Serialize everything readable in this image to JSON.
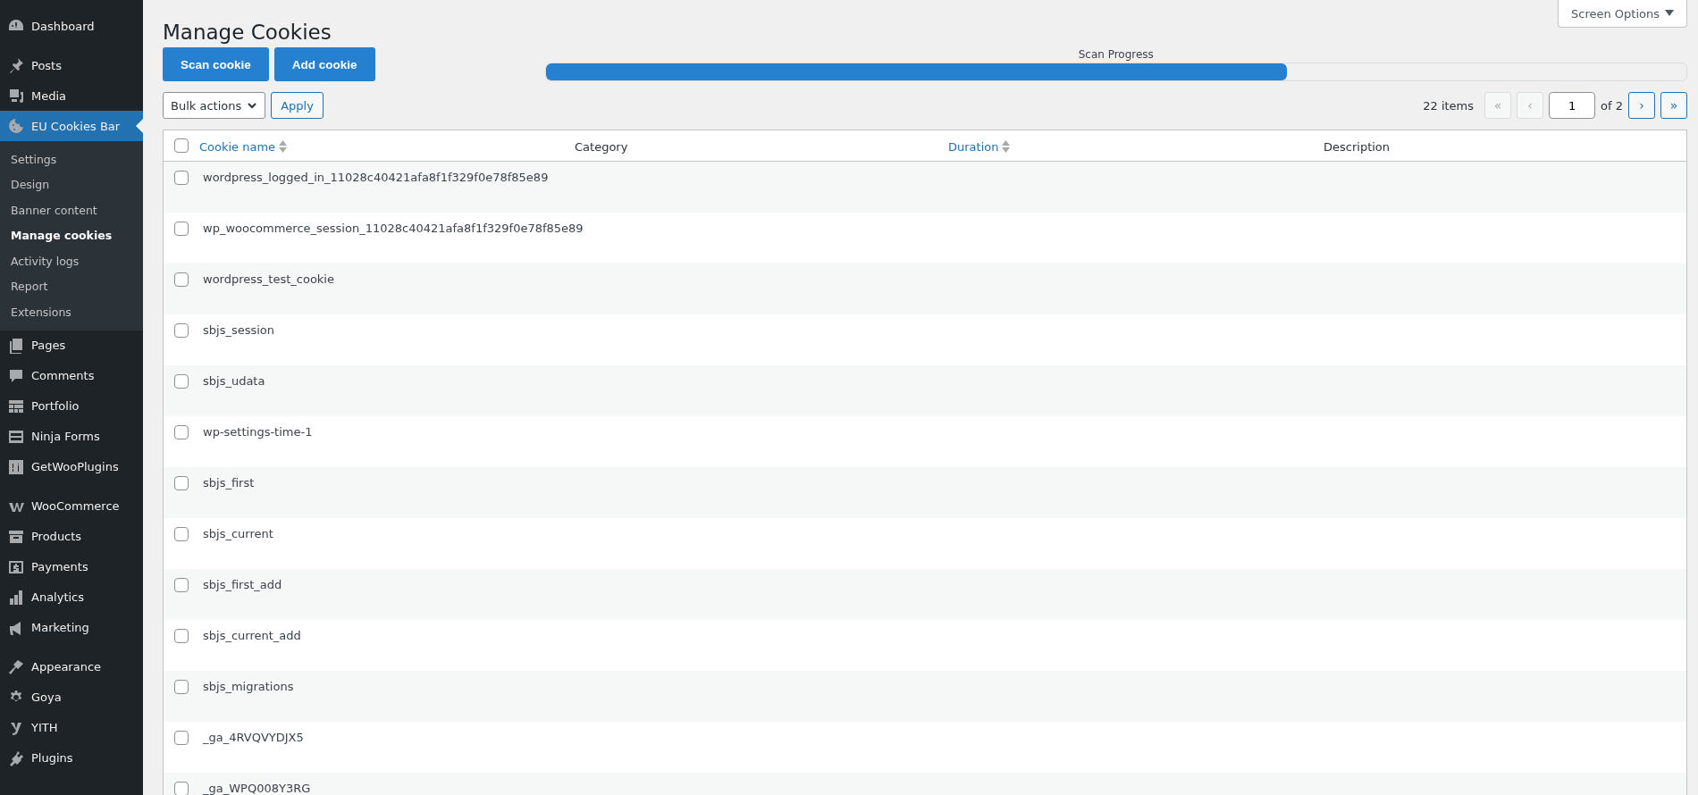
{
  "sidebar": {
    "groups": [
      [
        {
          "label": "Dashboard",
          "selected": false
        }
      ],
      [
        {
          "label": "Posts",
          "selected": false
        },
        {
          "label": "Media",
          "selected": false
        },
        {
          "label": "EU Cookies Bar",
          "selected": true,
          "submenu": [
            {
              "label": "Settings",
              "selected": false
            },
            {
              "label": "Design",
              "selected": false
            },
            {
              "label": "Banner content",
              "selected": false
            },
            {
              "label": "Manage cookies",
              "selected": true
            },
            {
              "label": "Activity logs",
              "selected": false
            },
            {
              "label": "Report",
              "selected": false
            },
            {
              "label": "Extensions",
              "selected": false
            }
          ]
        },
        {
          "label": "Pages",
          "selected": false
        },
        {
          "label": "Comments",
          "selected": false
        },
        {
          "label": "Portfolio",
          "selected": false
        },
        {
          "label": "Ninja Forms",
          "selected": false
        },
        {
          "label": "GetWooPlugins",
          "selected": false
        }
      ],
      [
        {
          "label": "WooCommerce",
          "selected": false
        },
        {
          "label": "Products",
          "selected": false
        },
        {
          "label": "Payments",
          "selected": false
        },
        {
          "label": "Analytics",
          "selected": false
        },
        {
          "label": "Marketing",
          "selected": false
        }
      ],
      [
        {
          "label": "Appearance",
          "selected": false
        },
        {
          "label": "Goya",
          "selected": false
        },
        {
          "label": "YITH",
          "selected": false
        },
        {
          "label": "Plugins",
          "selected": false
        }
      ]
    ]
  },
  "screen_options": "Screen Options",
  "title": "Manage Cookies",
  "actions": [
    "Scan cookie",
    "Add cookie"
  ],
  "scan_progress": {
    "label": "Scan Progress",
    "level": 0.65
  },
  "bulk_actions": {
    "value": "Bulk actions",
    "apply": "Apply"
  },
  "pagination": {
    "count": "22 items",
    "first": "«",
    "prev": "‹",
    "page": "1",
    "of": "of 2",
    "next": "›",
    "last": "»",
    "first_disabled": true,
    "prev_disabled": true,
    "next_disabled": false,
    "last_disabled": false
  },
  "table": {
    "select_all_checked": false,
    "columns": [
      {
        "label": "Cookie name",
        "sortable": true
      },
      {
        "label": "Category",
        "sortable": false
      },
      {
        "label": "Duration",
        "sortable": true
      },
      {
        "label": "Description",
        "sortable": false
      }
    ],
    "rows": [
      {
        "name": "wordpress_logged_in_11028c40421afa8f1f329f0e78f85e89",
        "checked": false
      },
      {
        "name": "wp_woocommerce_session_11028c40421afa8f1f329f0e78f85e89",
        "checked": false
      },
      {
        "name": "wordpress_test_cookie",
        "checked": false
      },
      {
        "name": "sbjs_session",
        "checked": false
      },
      {
        "name": "sbjs_udata",
        "checked": false
      },
      {
        "name": "wp-settings-time-1",
        "checked": false
      },
      {
        "name": "sbjs_first",
        "checked": false
      },
      {
        "name": "sbjs_current",
        "checked": false
      },
      {
        "name": "sbjs_first_add",
        "checked": false
      },
      {
        "name": "sbjs_current_add",
        "checked": false
      },
      {
        "name": "sbjs_migrations",
        "checked": false
      },
      {
        "name": "_ga_4RVQVYDJX5",
        "checked": false
      },
      {
        "name": "_ga_WPQ008Y3RG",
        "checked": false
      }
    ]
  }
}
